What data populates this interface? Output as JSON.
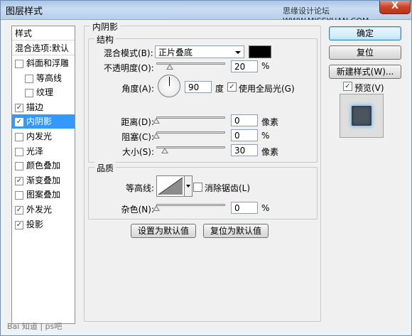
{
  "window": {
    "title": "图层样式",
    "watermark_top": "思缘设计论坛 WWW.MISSYUAN.COM",
    "close_label": "X",
    "watermark_bottom": "Bai 知道 | ps吧"
  },
  "style_list": {
    "header": "样式",
    "blend_options": "混合选项:默认",
    "items": [
      {
        "label": "斜面和浮雕",
        "checked": false,
        "indent": false
      },
      {
        "label": "等高线",
        "checked": false,
        "indent": true
      },
      {
        "label": "纹理",
        "checked": false,
        "indent": true
      },
      {
        "label": "描边",
        "checked": true,
        "indent": false
      },
      {
        "label": "内阴影",
        "checked": true,
        "indent": false,
        "selected": true
      },
      {
        "label": "内发光",
        "checked": false,
        "indent": false
      },
      {
        "label": "光泽",
        "checked": false,
        "indent": false
      },
      {
        "label": "颜色叠加",
        "checked": false,
        "indent": false
      },
      {
        "label": "渐变叠加",
        "checked": true,
        "indent": false
      },
      {
        "label": "图案叠加",
        "checked": false,
        "indent": false
      },
      {
        "label": "外发光",
        "checked": true,
        "indent": false
      },
      {
        "label": "投影",
        "checked": true,
        "indent": false
      }
    ]
  },
  "inner_shadow": {
    "title": "内阴影",
    "structure": {
      "title": "结构",
      "blend_mode_label": "混合模式(B):",
      "blend_mode_value": "正片叠底",
      "blend_color": "#000000",
      "opacity_label": "不透明度(O):",
      "opacity_value": "20",
      "opacity_unit": "%",
      "angle_label": "角度(A):",
      "angle_value": "90",
      "angle_unit": "度",
      "global_light_label": "使用全局光(G)",
      "global_light_checked": true,
      "distance_label": "距离(D):",
      "distance_value": "0",
      "distance_unit": "像素",
      "choke_label": "阻塞(C):",
      "choke_value": "0",
      "choke_unit": "%",
      "size_label": "大小(S):",
      "size_value": "30",
      "size_unit": "像素"
    },
    "quality": {
      "title": "品质",
      "contour_label": "等高线:",
      "anti_alias_label": "消除锯齿(L)",
      "anti_alias_checked": false,
      "noise_label": "杂色(N):",
      "noise_value": "0",
      "noise_unit": "%"
    },
    "make_default": "设置为默认值",
    "reset_default": "复位为默认值"
  },
  "buttons": {
    "ok": "确定",
    "reset": "复位",
    "new_style": "新建样式(W)...",
    "preview_label": "预览(V)",
    "preview_checked": true
  }
}
